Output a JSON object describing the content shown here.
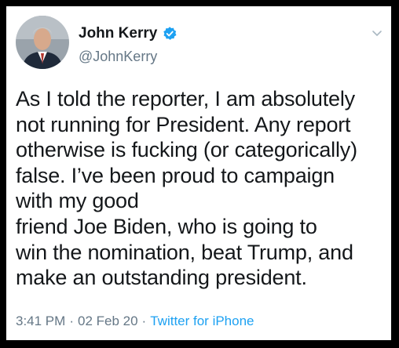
{
  "tweet": {
    "author": {
      "display_name": "John Kerry",
      "handle": "@JohnKerry",
      "verified": true,
      "avatar_icon": "profile-photo"
    },
    "text": "As I told the reporter, I am absolutely\nnot running for President. Any report\notherwise is fucking (or categorically)\nfalse. I’ve been proud to campaign\nwith my good\nfriend Joe Biden, who is going to\nwin the nomination, beat Trump, and\nmake an outstanding president.",
    "time": "3:41 PM",
    "separator": "·",
    "date": "02 Feb 20",
    "source": "Twitter for iPhone"
  },
  "colors": {
    "link": "#1da1f2",
    "muted": "#657786",
    "text": "#14171a",
    "border": "#000000"
  }
}
